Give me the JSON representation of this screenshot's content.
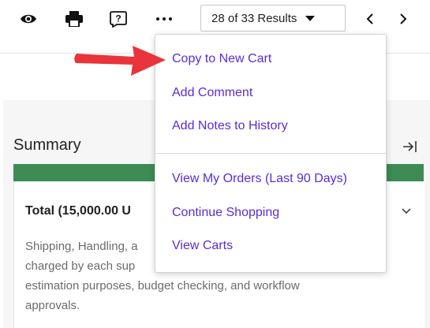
{
  "toolbar": {
    "results_label": "28 of 33 Results",
    "icons": [
      "eye-icon",
      "print-icon",
      "help-icon",
      "more-icon",
      "chevron-left-icon",
      "chevron-right-icon"
    ]
  },
  "menu": {
    "items_top": [
      "Copy to New Cart",
      "Add Comment",
      "Add Notes to History"
    ],
    "items_bottom": [
      "View My Orders (Last 90 Days)",
      "Continue Shopping",
      "View Carts"
    ]
  },
  "summary": {
    "title": "Summary",
    "total_label": "Total (15,000.00 U",
    "description_lines": [
      "Shipping, Handling, a",
      "charged by each sup",
      "estimation purposes, budget checking, and workflow",
      "approvals."
    ]
  },
  "colors": {
    "accent_green": "#3d8b55",
    "link_purple": "#5b2bd6",
    "annotation_red": "#e8343a"
  }
}
